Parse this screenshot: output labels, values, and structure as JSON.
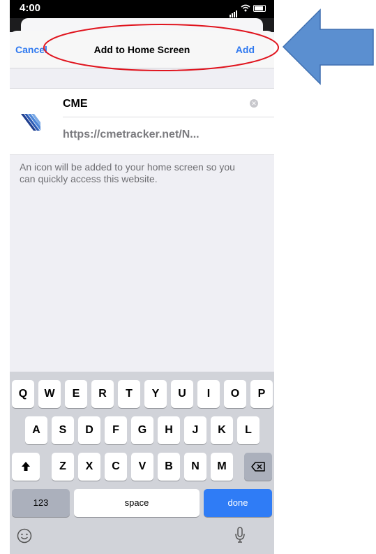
{
  "status_bar": {
    "time": "4:00"
  },
  "nav": {
    "cancel_label": "Cancel",
    "title": "Add to Home Screen",
    "add_label": "Add"
  },
  "form": {
    "name_value": "CME",
    "url": "https://cmetracker.net/N..."
  },
  "help_text": "An icon will be added to your home screen so you can quickly access this website.",
  "keyboard": {
    "row1": [
      "Q",
      "W",
      "E",
      "R",
      "T",
      "Y",
      "U",
      "I",
      "O",
      "P"
    ],
    "row2": [
      "A",
      "S",
      "D",
      "F",
      "G",
      "H",
      "J",
      "K",
      "L"
    ],
    "row3": [
      "Z",
      "X",
      "C",
      "V",
      "B",
      "N",
      "M"
    ],
    "numbers_label": "123",
    "space_label": "space",
    "done_label": "done"
  },
  "colors": {
    "accent": "#2f79f0",
    "annotation_red": "#e0141e",
    "arrow_blue": "#5b8fd0"
  }
}
